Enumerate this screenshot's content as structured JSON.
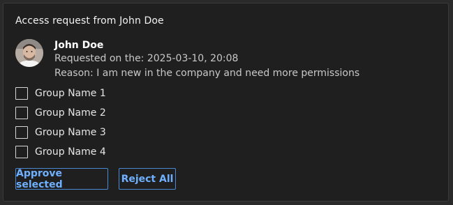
{
  "card": {
    "title": "Access request from John Doe"
  },
  "requester": {
    "name": "John Doe",
    "requested_on": "Requested on the: 2025-03-10, 20:08",
    "reason": "Reason: I am new in the company and need more permissions"
  },
  "groups": [
    {
      "label": "Group Name 1",
      "checked": false
    },
    {
      "label": "Group Name 2",
      "checked": false
    },
    {
      "label": "Group Name 3",
      "checked": false
    },
    {
      "label": "Group Name 4",
      "checked": false
    }
  ],
  "actions": {
    "approve_label": "Approve selected",
    "reject_label": "Reject All"
  },
  "colors": {
    "accent": "#6fb0ff",
    "accent_border": "#4a8ad4",
    "card_background": "#1f1f1f",
    "page_background": "#2a2a2a"
  }
}
